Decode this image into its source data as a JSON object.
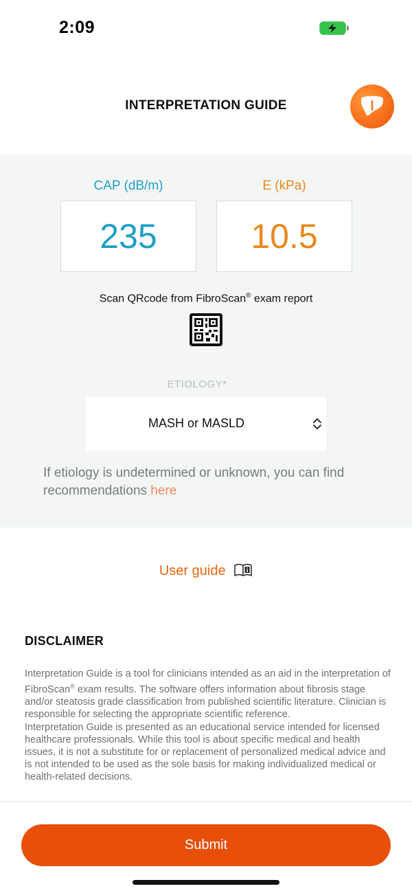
{
  "status_bar": {
    "time": "2:09",
    "battery_icon": "battery-charging-icon",
    "battery_color": "#37c24a"
  },
  "header": {
    "title": "INTERPRETATION GUIDE",
    "logo_icon": "liver-icon",
    "logo_color": "#f7711c"
  },
  "metrics": {
    "cap_label": "CAP (dB/m)",
    "cap_value": "235",
    "cap_color": "#1f9fc6",
    "e_label": "E (kPa)",
    "e_value": "10.5",
    "e_color": "#e8891d"
  },
  "qr": {
    "label_main": "Scan QRcode from FibroScan",
    "label_reg": "®",
    "label_tail": " exam report",
    "icon": "qr-code-icon"
  },
  "etiology": {
    "label": "ETIOLOGY*",
    "selected": "MASH or MASLD"
  },
  "help": {
    "text": "If etiology is undetermined or unknown, you can find recommendations ",
    "link": "here"
  },
  "user_guide": {
    "label": "User guide",
    "icon": "book-info-icon"
  },
  "disclaimer": {
    "title": "DISCLAIMER",
    "p1_a": "Interpretation Guide is a tool for clinicians intended as an aid in the interpretation of FibroScan",
    "p1_reg": "®",
    "p1_b": " exam results. The software offers information about fibrosis stage and/or steatosis grade classification from published scientific literature. Clinician is responsible for selecting the appropriate scientific reference.",
    "p2": "Interpretation Guide is presented as an educational service intended for licensed healthcare professionals. While this tool is about specific medical and health issues, it is not a substitute for or replacement of personalized medical advice and is not intended to be used as the sole basis for making individualized medical or health-related decisions."
  },
  "submit": {
    "label": "Submit",
    "color": "#e8500a"
  }
}
